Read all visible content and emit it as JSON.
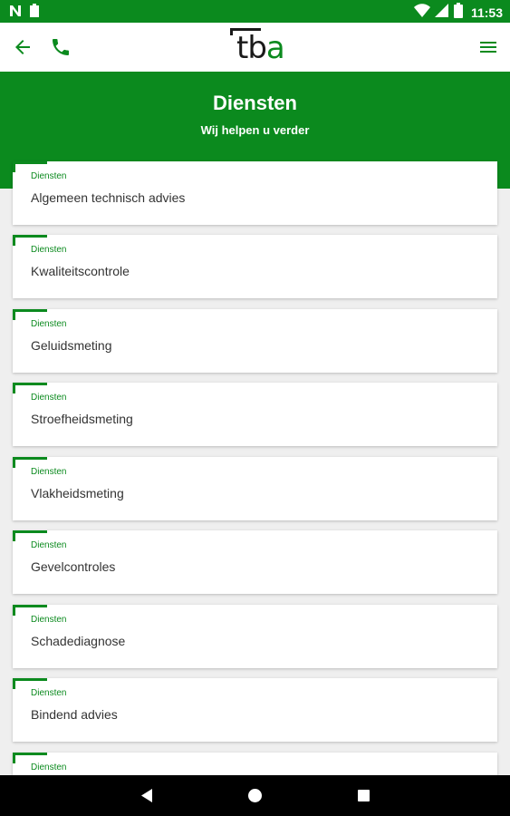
{
  "status_bar": {
    "time": "11:53",
    "icons": [
      "n-icon",
      "clipboard-icon",
      "wifi-icon",
      "signal-icon",
      "battery-icon"
    ]
  },
  "app_bar": {
    "logo_text_dark": "tb",
    "logo_text_accent": "a",
    "icons": [
      "arrow-left-icon",
      "phone-icon",
      "hamburger-menu-icon"
    ]
  },
  "header": {
    "title": "Diensten",
    "subtitle": "Wij helpen u verder"
  },
  "services": [
    {
      "category": "Diensten",
      "title": "Algemeen technisch advies"
    },
    {
      "category": "Diensten",
      "title": "Kwaliteitscontrole"
    },
    {
      "category": "Diensten",
      "title": "Geluidsmeting"
    },
    {
      "category": "Diensten",
      "title": "Stroefheidsmeting"
    },
    {
      "category": "Diensten",
      "title": "Vlakheidsmeting"
    },
    {
      "category": "Diensten",
      "title": "Gevelcontroles"
    },
    {
      "category": "Diensten",
      "title": "Schadediagnose"
    },
    {
      "category": "Diensten",
      "title": "Bindend advies"
    },
    {
      "category": "Diensten",
      "title": ""
    }
  ],
  "nav_bar": {
    "icons": [
      "nav-back-icon",
      "nav-home-icon",
      "nav-recents-icon"
    ]
  },
  "colors": {
    "brand_green": "#0b8a1e",
    "background": "#efefef",
    "text_dark": "#333333"
  }
}
